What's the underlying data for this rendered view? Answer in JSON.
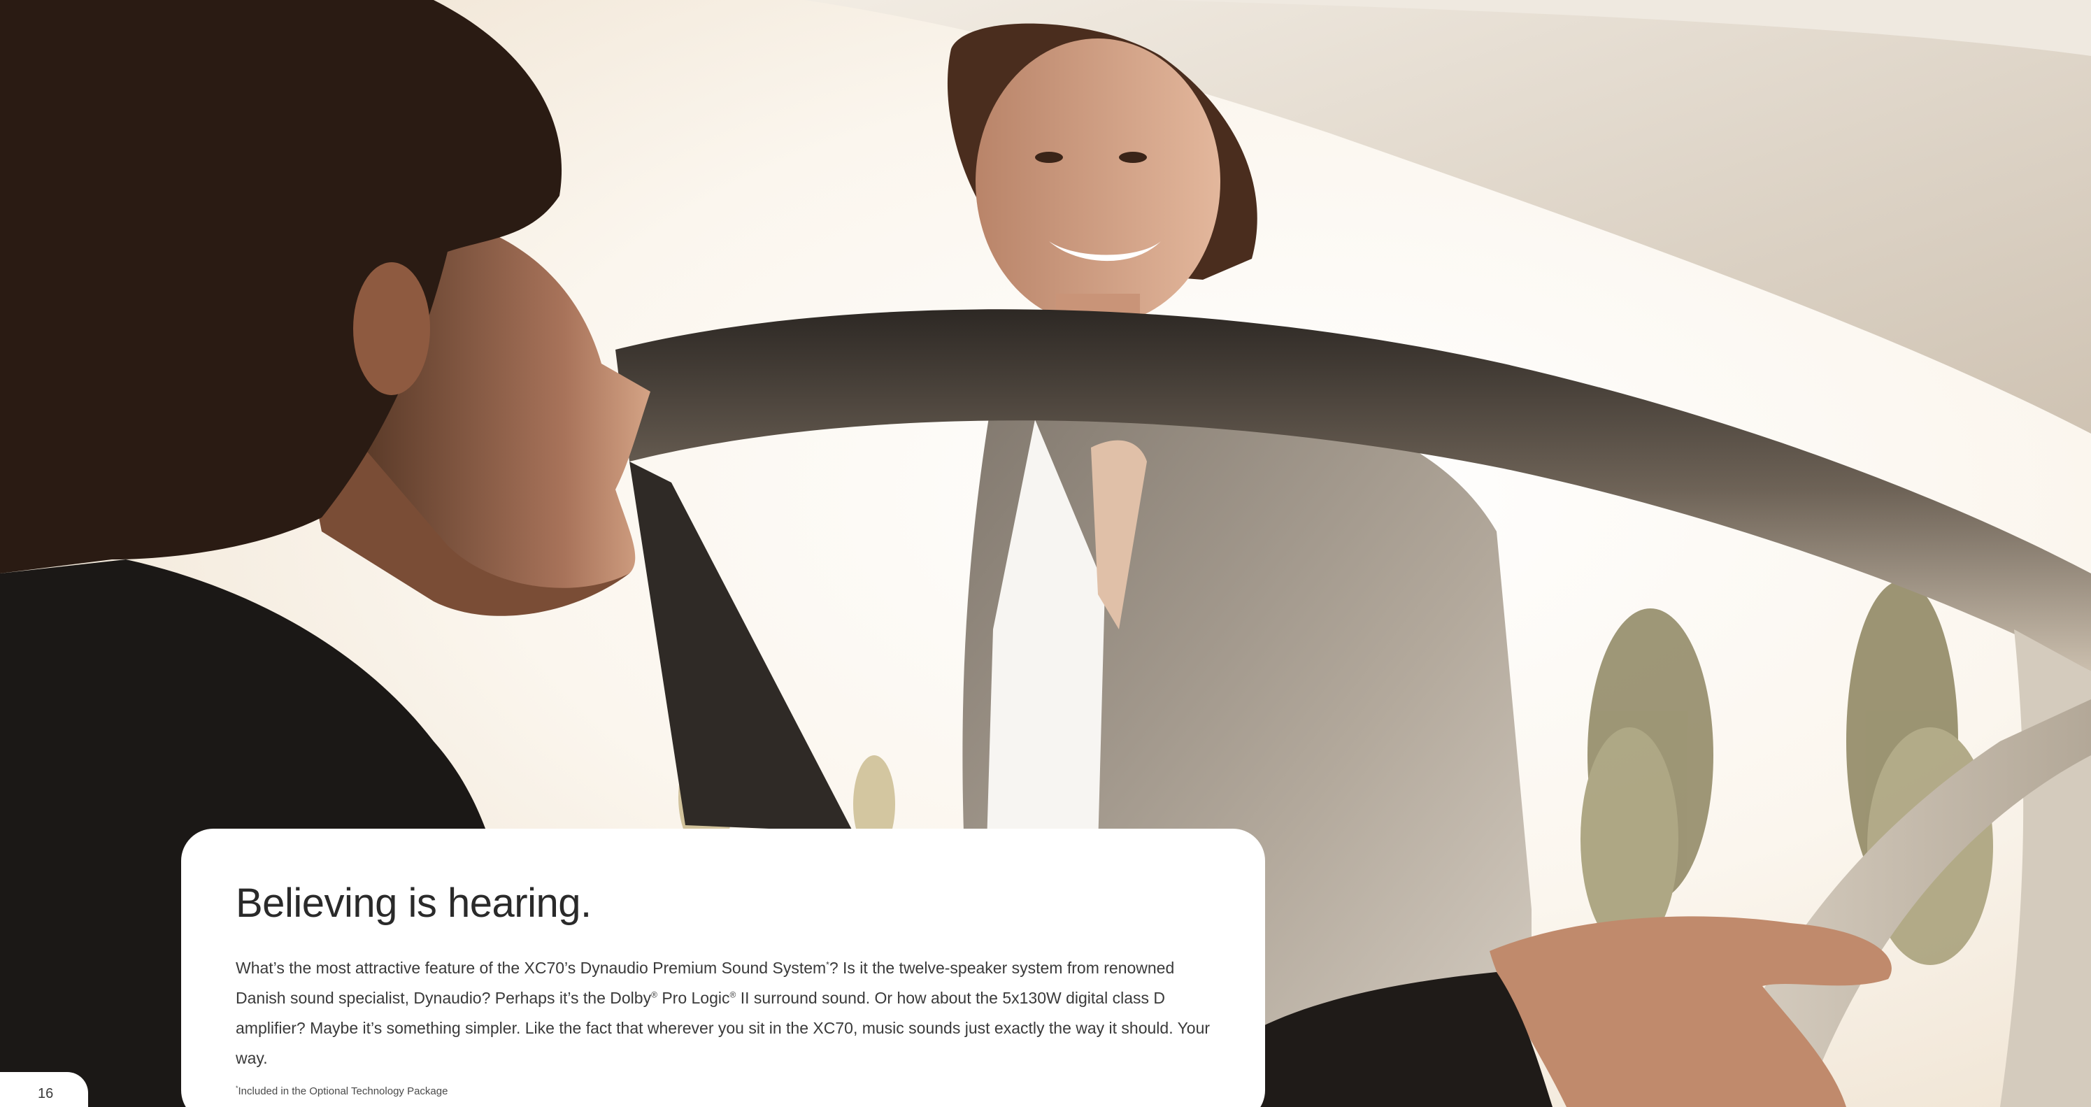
{
  "photo": {
    "subject": "man-in-car-and-smiling-woman-at-open-door",
    "palette": {
      "sky": "#fbf7f0",
      "warm_light": "#f4e6cf",
      "hair_dark": "#2b1c14",
      "skin": "#b88466",
      "jacket_dark": "#1c1917",
      "door_frame": "#3b3530",
      "headliner": "#e6ddd1",
      "blazer": "#9a9084",
      "foliage": "#8a8158"
    }
  },
  "card": {
    "title": "Believing is hearing.",
    "body_p1": "What’s the most attractive feature of the XC70’s Dynaudio Premium Sound System",
    "body_mark1": "*",
    "body_p2": "? Is it the twelve-speaker system from renowned Danish sound specialist, Dynaudio? Perhaps it’s the Dolby",
    "body_reg1": "®",
    "body_p3": " Pro Logic",
    "body_reg2": "®",
    "body_p4": " II surround sound. Or how about the 5x130W digital class D amplifier? Maybe it’s something simpler. Like the fact that wherever you sit in the XC70, music sounds just exactly the way it should. Your way.",
    "footnote_mark": "*",
    "footnote_text": "Included in the Optional Technology Package"
  },
  "page_number": "16"
}
